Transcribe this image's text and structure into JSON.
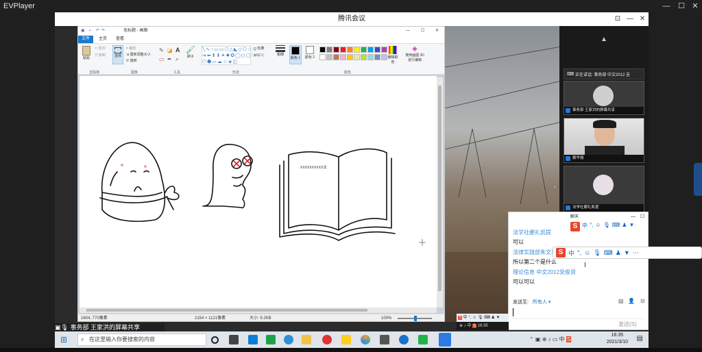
{
  "evplayer": {
    "title": "EVPlayer"
  },
  "meeting": {
    "title": "腾讯会议"
  },
  "paint": {
    "window_title": "无标题 - 画图",
    "tabs": [
      "文件",
      "主页",
      "查看"
    ],
    "groups": [
      "剪贴板",
      "图像",
      "工具",
      "形状",
      "颜色"
    ],
    "buttons": {
      "paste": "粘贴",
      "cut": "剪切",
      "copy": "复制",
      "select": "选择",
      "crop": "裁剪",
      "resize": "重新调整大小",
      "rotate": "旋转",
      "brush": "刷子",
      "outline": "轮廓",
      "fill": "填充",
      "size": "粗细",
      "color1": "颜色 1",
      "color2": "颜色 2",
      "edit_colors": "编辑颜色",
      "paint3d": "使用画图 3D 进行编辑"
    },
    "palette": [
      "#000000",
      "#7f7f7f",
      "#880015",
      "#ed1c24",
      "#ff7f27",
      "#fff200",
      "#22b14c",
      "#00a2e8",
      "#3f48cc",
      "#a349a4",
      "#ffffff",
      "#c3c3c3",
      "#b97a57",
      "#ffaec9",
      "#ffc90e",
      "#efe4b0",
      "#b5e61d",
      "#99d9ea",
      "#7092be",
      "#c8bfe7"
    ],
    "canvas_text": "XXXXXXXXXX法",
    "status": {
      "position": "1604, 770像素",
      "dimensions": "2154 × 1121像素",
      "filesize": "大小: 9.2KB",
      "zoom": "100%"
    }
  },
  "participants": [
    {
      "name": "事务部 王家洪的屏幕共享"
    },
    {
      "name": "赖华强"
    },
    {
      "name": "法学社娜扎凯提"
    }
  ],
  "speaking": "正在讲话: 事务部 中文2012 吉",
  "chat": {
    "title": "聊天",
    "messages": [
      {
        "sender": "法学社娜扎凯提",
        "text": "可以"
      },
      {
        "sender": "法律实践部朱文君",
        "text": "所以第二个是什么"
      },
      {
        "sender": "理论信息 中文2012吴俊贤",
        "text": "可以可以"
      }
    ],
    "send_to_label": "发送至:",
    "send_to_value": "所有人",
    "send_button": "发送(S)"
  },
  "ime": {
    "mode": "中",
    "punct": "°,"
  },
  "presenter_bar": "事务部 王家洪的屏幕共享",
  "taskbar": {
    "search_placeholder": "在这里输入你要搜索的内容",
    "time": "16:35",
    "date": "2021/3/10",
    "ime": "中"
  },
  "inner_taskbar_time": "16:35"
}
